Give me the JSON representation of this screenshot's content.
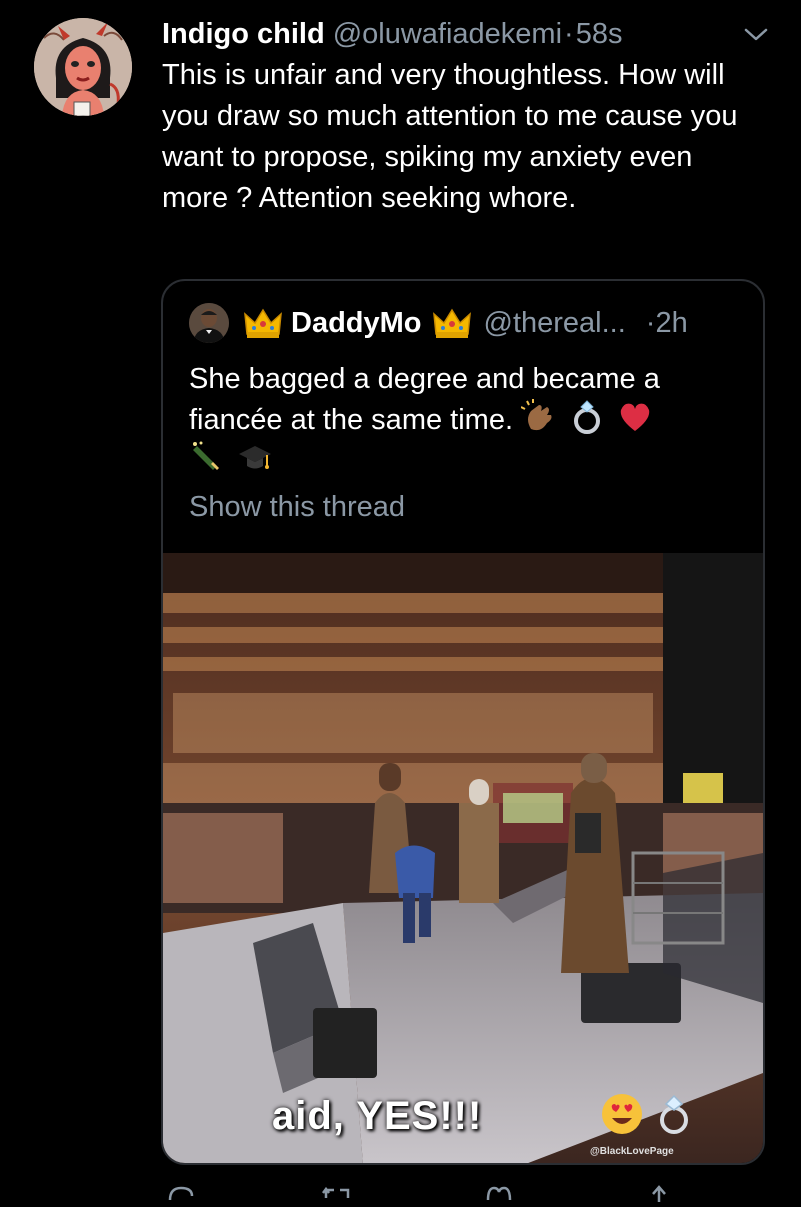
{
  "tweet": {
    "display_name": "Indigo child",
    "handle": "@oluwafiadekemi",
    "separator": "·",
    "time": "58s",
    "text": "This is unfair and very thoughtless. How will you draw so much attention to me cause you want to propose, spiking my anxiety even more ? Attention seeking whore.",
    "avatar_icon": "devil-girl-avatar",
    "menu_icon": "chevron-down-icon"
  },
  "quote": {
    "display_name": "DaddyMo",
    "handle": "@thereal...",
    "separator": "·",
    "time": "2h",
    "text": "She bagged a degree and became a fiancée at the same time.",
    "emojis": [
      "clapping-hands-emoji",
      "ring-emoji",
      "red-heart-emoji",
      "champagne-emoji",
      "graduation-cap-emoji"
    ],
    "show_thread": "Show this thread",
    "media": {
      "caption": "aid, YES!!!",
      "watermark": "@BlackLovePage",
      "caption_emojis": [
        "heart-eyes-emoji",
        "ring-emoji"
      ]
    }
  },
  "actions": [
    "reply-icon",
    "retweet-icon",
    "like-icon",
    "share-icon"
  ],
  "colors": {
    "background": "#000000",
    "primary_text": "#ffffff",
    "secondary_text": "#8b98a5",
    "border": "#2b2e33"
  }
}
